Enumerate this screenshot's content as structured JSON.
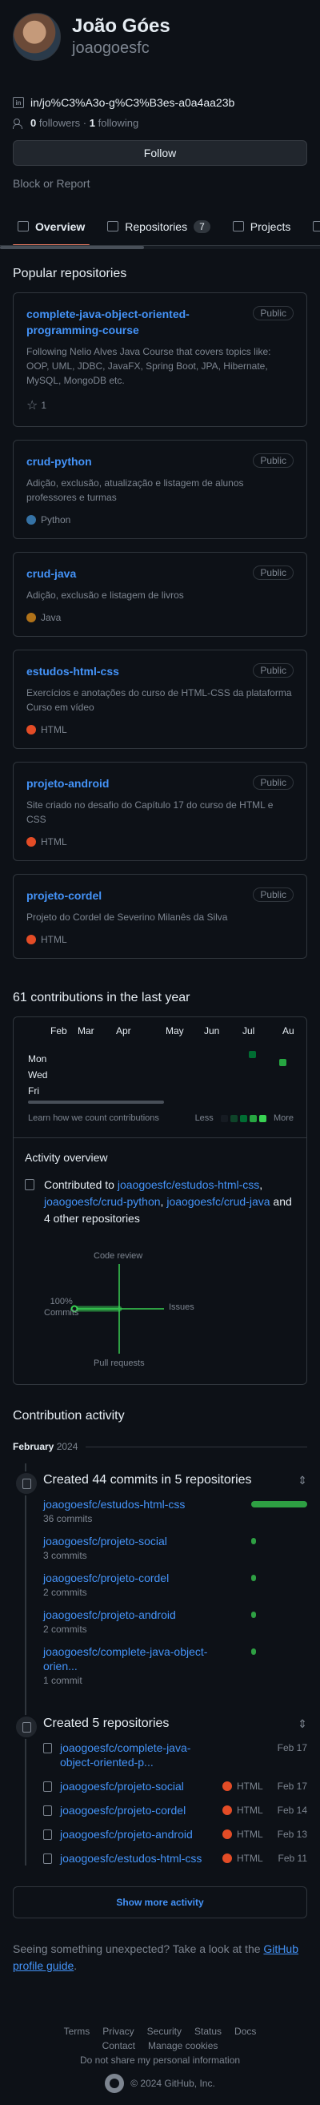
{
  "profile": {
    "full_name": "João Góes",
    "username": "joaogoesfc",
    "link": "in/jo%C3%A3o-g%C3%B3es-a0a4aa23b",
    "followers_count": "0",
    "followers_label": "followers",
    "separator": "·",
    "following_count": "1",
    "following_label": "following",
    "follow_label": "Follow",
    "block_report_label": "Block or Report"
  },
  "tabs": [
    {
      "label": "Overview",
      "icon": "book-icon",
      "active": true
    },
    {
      "label": "Repositories",
      "icon": "repo-icon",
      "count": "7"
    },
    {
      "label": "Projects",
      "icon": "table-icon"
    },
    {
      "label": "",
      "icon": "package-icon"
    }
  ],
  "popular": {
    "title": "Popular repositories",
    "repos": [
      {
        "name": "complete-java-object-oriented-programming-course",
        "badge": "Public",
        "desc": "Following Nelio Alves Java Course that covers topics like: OOP, UML, JDBC, JavaFX, Spring Boot, JPA, Hibernate, MySQL, MongoDB etc.",
        "stars": "1"
      },
      {
        "name": "crud-python",
        "badge": "Public",
        "desc": "Adição, exclusão, atualização e listagem de alunos professores e turmas",
        "lang": "Python",
        "color": "#3572A5"
      },
      {
        "name": "crud-java",
        "badge": "Public",
        "desc": "Adição, exclusão e listagem de livros",
        "lang": "Java",
        "color": "#b07219"
      },
      {
        "name": "estudos-html-css",
        "badge": "Public",
        "desc": "Exercícios e anotações do curso de HTML-CSS da plataforma Curso em vídeo",
        "lang": "HTML",
        "color": "#e34c26"
      },
      {
        "name": "projeto-android",
        "badge": "Public",
        "desc": "Site criado no desafio do Capítulo 17 do curso de HTML e CSS",
        "lang": "HTML",
        "color": "#e34c26"
      },
      {
        "name": "projeto-cordel",
        "badge": "Public",
        "desc": "Projeto do Cordel de Severino Milanês da Silva",
        "lang": "HTML",
        "color": "#e34c26"
      }
    ]
  },
  "contributions": {
    "title": "61 contributions in the last year",
    "months": [
      "Feb",
      "Mar",
      "Apr",
      "May",
      "Jun",
      "Jul",
      "Au"
    ],
    "days": [
      "Mon",
      "Wed",
      "Fri"
    ],
    "learn_label": "Learn how we count contributions",
    "less_label": "Less",
    "more_label": "More",
    "legend_colors": [
      "#161b22",
      "#0e4429",
      "#006d32",
      "#26a641",
      "#39d353"
    ]
  },
  "activity_overview": {
    "title": "Activity overview",
    "contributed_to": "Contributed to",
    "repo1": "joaogoesfc/estudos-html-css",
    "comma1": ",",
    "repo2": "joaogoesfc/crud-python",
    "comma2": ",",
    "repo3": "joaogoesfc/crud-java",
    "others": "and 4 other repositories",
    "axis_top": "Code review",
    "axis_right": "Issues",
    "axis_bottom": "Pull requests",
    "axis_left_pct": "100%",
    "axis_left_label": "Commits",
    "commits_pct": 100
  },
  "contribution_activity": {
    "title": "Contribution activity",
    "month_label": "February",
    "year_label": "2024",
    "commits_header": "Created 44 commits in 5 repositories",
    "commit_repos": [
      {
        "name": "joaogoesfc/estudos-html-css",
        "count": "36 commits",
        "value": 36
      },
      {
        "name": "joaogoesfc/projeto-social",
        "count": "3 commits",
        "value": 3
      },
      {
        "name": "joaogoesfc/projeto-cordel",
        "count": "2 commits",
        "value": 2
      },
      {
        "name": "joaogoesfc/projeto-android",
        "count": "2 commits",
        "value": 2
      },
      {
        "name": "joaogoesfc/complete-java-object-orien...",
        "count": "1 commit",
        "value": 1
      }
    ],
    "created_header": "Created 5 repositories",
    "created_repos": [
      {
        "name": "joaogoesfc/complete-java-object-oriented-p...",
        "lang": "",
        "date": "Feb 17"
      },
      {
        "name": "joaogoesfc/projeto-social",
        "lang": "HTML",
        "date": "Feb 17"
      },
      {
        "name": "joaogoesfc/projeto-cordel",
        "lang": "HTML",
        "date": "Feb 14"
      },
      {
        "name": "joaogoesfc/projeto-android",
        "lang": "HTML",
        "date": "Feb 13"
      },
      {
        "name": "joaogoesfc/estudos-html-css",
        "lang": "HTML",
        "date": "Feb 11"
      }
    ],
    "show_more": "Show more activity",
    "unexpected_text": "Seeing something unexpected? Take a look at the",
    "unexpected_link": "GitHub profile guide",
    "unexpected_end": "."
  },
  "footer": {
    "links": [
      "Terms",
      "Privacy",
      "Security",
      "Status",
      "Docs",
      "Contact",
      "Manage cookies",
      "Do not share my personal information"
    ],
    "copyright": "© 2024 GitHub, Inc."
  },
  "colors": {
    "accent": "#4493f8",
    "tab_underline": "#f78166",
    "html": "#e34c26",
    "python": "#3572A5",
    "java": "#b07219",
    "green": "#2ea043"
  }
}
